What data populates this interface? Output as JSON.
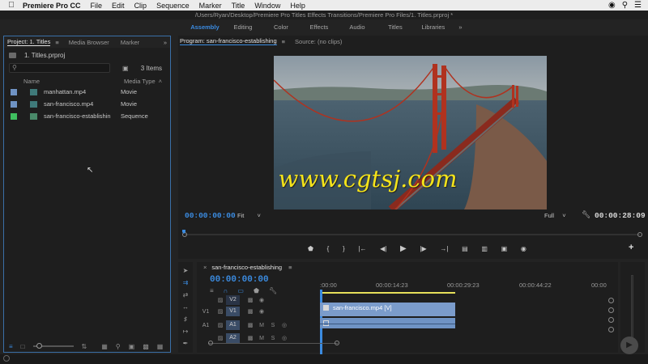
{
  "menubar": {
    "app": "Premiere Pro CC",
    "items": [
      "File",
      "Edit",
      "Clip",
      "Sequence",
      "Marker",
      "Title",
      "Window",
      "Help"
    ]
  },
  "window": {
    "path": "/Users/Ryan/Desktop/Premiere Pro Titles Effects Transitions/Premiere Pro Files/1. Titles.prproj *"
  },
  "workspaces": {
    "items": [
      "Assembly",
      "Editing",
      "Color",
      "Effects",
      "Audio",
      "Titles",
      "Libraries"
    ],
    "active": "Assembly",
    "more": "»"
  },
  "project": {
    "tabs": [
      "Project: 1. Titles",
      "Media Browser",
      "Marker"
    ],
    "tab_more": "»",
    "file": "1. Titles.prproj",
    "search_placeholder": "",
    "item_count": "3 Items",
    "col_name": "Name",
    "col_type": "Media Type",
    "rows": [
      {
        "name": "manhattan.mp4",
        "type": "Movie",
        "swatch": "#6f93c4"
      },
      {
        "name": "san-francisco.mp4",
        "type": "Movie",
        "swatch": "#6f93c4"
      },
      {
        "name": "san-francisco-establishin",
        "type": "Sequence",
        "swatch": "#3fbf5f"
      }
    ]
  },
  "program": {
    "tabs": [
      "Program: san-francisco-establishing",
      "Source: (no clips)"
    ],
    "timecode": "00:00:00:00",
    "fit": "Fit",
    "quality": "Full",
    "duration": "00:00:28:09",
    "watermark": "www.cgtsj.com"
  },
  "timeline": {
    "sequence": "san-francisco-establishing",
    "timecode": "00:00:00:00",
    "ruler": [
      ":00:00",
      "00:00:14:23",
      "00:00:29:23",
      "00:00:44:22",
      "00:00"
    ],
    "tracks": [
      {
        "label": "V2"
      },
      {
        "label": "V1",
        "src": "V1"
      },
      {
        "label": "A1",
        "src": "A1"
      },
      {
        "label": "A2"
      }
    ],
    "video_clip": "san-francisco.mp4 [V]",
    "track_letters": [
      "M",
      "S"
    ]
  },
  "colors": {
    "accent": "#3b8be0",
    "clip_video": "#7b9ccb",
    "clip_audio": "#6f93c4",
    "watermark": "#f5e41a"
  }
}
